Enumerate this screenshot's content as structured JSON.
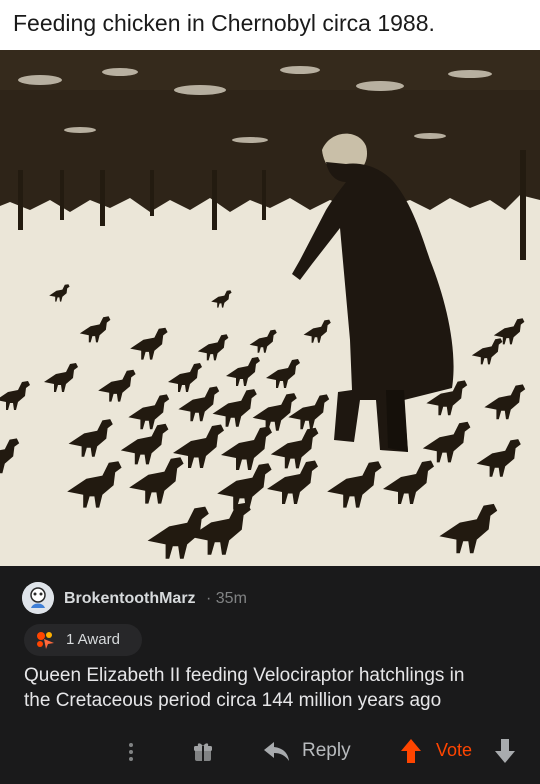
{
  "post": {
    "title": "Feeding chicken in Chernobyl circa 1988."
  },
  "photo": {
    "icon": "sepia-photo-woman-feeding-birds"
  },
  "comment": {
    "username": "BrokentoothMarz",
    "age": "· 35m",
    "award_label": "1 Award",
    "award_icon": "award-icon",
    "body_line1": "Queen Elizabeth II feeding Velociraptor hatchlings in",
    "body_line2": "the Cretaceous period circa 144 million years ago"
  },
  "actions": {
    "reply_label": "Reply",
    "vote_label": "Vote",
    "vote_color": "#ff4500"
  },
  "colors": {
    "panel_bg": "#1a1a1b",
    "award_pill": "#272729",
    "text_primary": "#d7dadc",
    "text_muted": "#818384"
  }
}
